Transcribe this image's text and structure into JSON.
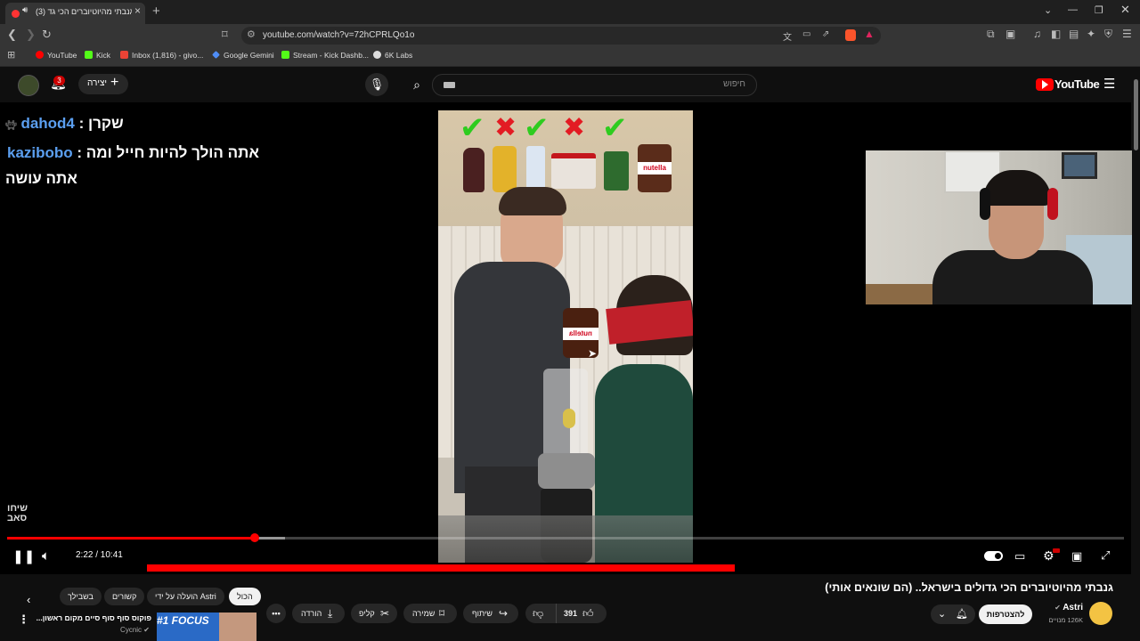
{
  "browser": {
    "tab_title": "(3) גנבתי מהיוטיוברים הכי גד",
    "url": "youtube.com/watch?v=72hCPRLQo1o",
    "bookmarks": [
      {
        "label": "YouTube",
        "color": "#ff0000"
      },
      {
        "label": "Kick",
        "color": "#53fc18"
      },
      {
        "label": "Inbox (1,816) - givo...",
        "color": "#ea4335"
      },
      {
        "label": "Google Gemini",
        "color": "#4f8df5"
      },
      {
        "label": "Stream - Kick Dashb...",
        "color": "#53fc18"
      },
      {
        "label": "6K Labs",
        "color": "#ffffff"
      }
    ]
  },
  "youtube": {
    "logo_text": "YouTube",
    "create_label": "יצירה",
    "notifications_count": "3",
    "search_placeholder": "חיפוש"
  },
  "stream_overlay": {
    "chat": [
      {
        "user": "dahod4",
        "sep": " : ",
        "text": "שקרן"
      },
      {
        "user": "kazibobo",
        "sep": " : ",
        "text": "אתה הולך להיות חייל ומה"
      },
      {
        "user": "",
        "sep": "",
        "text": "אתה עושה"
      }
    ],
    "watermark": "שיחו\nסאב",
    "jar_label": "nutella"
  },
  "player": {
    "time_text": "2:22 / 10:41",
    "progress_fraction": 0.222,
    "buffered_fraction": 0.249
  },
  "video": {
    "title": "גנבתי מהיוטיוברים הכי גדולים בישראל.. (הם שונאים אותי)",
    "channel": "Astri",
    "subscribers": "126K מנויים",
    "subscribe_label": "להצטרפות",
    "likes": "391",
    "share_label": "שיתוף",
    "save_label": "שמירה",
    "clip_label": "קליפ",
    "download_label": "הורדה"
  },
  "related": {
    "filters": [
      "הכול",
      "הועלה על ידי Astri",
      "קשורים",
      "בשבילך"
    ],
    "selected_filter": "הכול",
    "item_title": "פוקוס סוף סוף סיים מקום ראשון...",
    "item_channel": "Cycnic",
    "thumb_text": "#1 FOCUS"
  }
}
